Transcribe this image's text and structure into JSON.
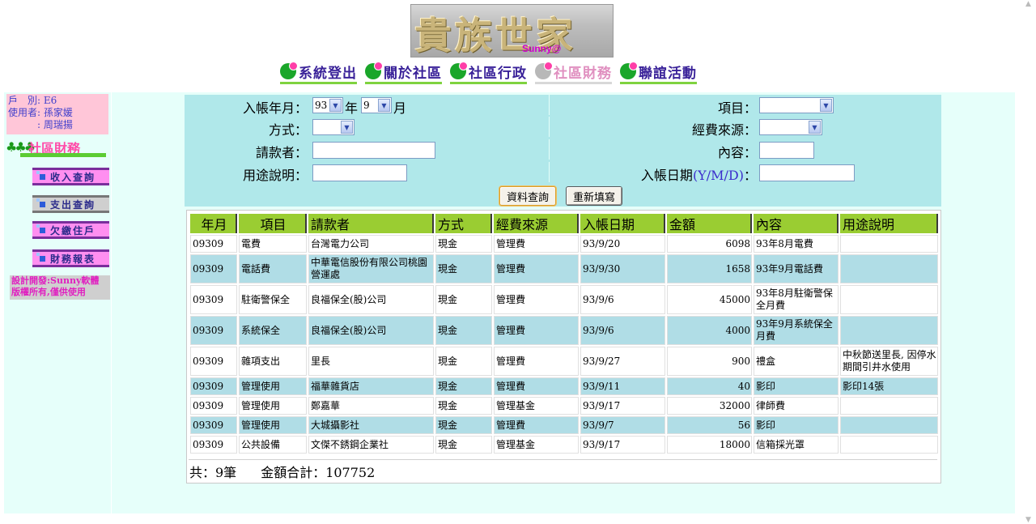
{
  "header": {
    "logo_title": "貴族世家",
    "logo_sub": "Sunny@",
    "nav": [
      "系統登出",
      "關於社區",
      "社區行政",
      "社區財務",
      "聯誼活動"
    ]
  },
  "sidebar": {
    "user_lines": [
      "戶　別: E6",
      "使用者: 孫家媛",
      "　　　: 周瑞揚"
    ],
    "section_title": "社區財務",
    "menu": [
      "收入查詢",
      "支出查詢",
      "欠繳住戶",
      "財務報表"
    ],
    "credit": [
      "設計開發:Sunny軟體",
      "版權所有,僅供使用"
    ]
  },
  "form": {
    "month_label": "入帳年月：",
    "year_value": "93",
    "year_unit": "年",
    "month_value": "9",
    "month_unit": "月",
    "item_label": "項目：",
    "item_value": "",
    "method_label": "方式：",
    "method_value": "",
    "source_label": "經費來源：",
    "source_value": "",
    "requester_label": "請款者：",
    "requester_value": "",
    "content_label": "內容：",
    "content_value": "",
    "purpose_label": "用途說明：",
    "purpose_value": "",
    "date_label": "入帳日期",
    "date_format": "(Y/M/D)",
    "date_colon": "：",
    "date_value": "",
    "query_button": "資料查詢",
    "reset_button": "重新填寫"
  },
  "table": {
    "headers": [
      "年月",
      "項目",
      "請款者",
      "方式",
      "經費來源",
      "入帳日期",
      "金額",
      "內容",
      "用途說明"
    ],
    "rows": [
      [
        "09309",
        "電費",
        "台灣電力公司",
        "現金",
        "管理費",
        "93/9/20",
        "6098",
        "93年8月電費",
        ""
      ],
      [
        "09309",
        "電話費",
        "中華電信股份有限公司桃園營運處",
        "現金",
        "管理費",
        "93/9/30",
        "1658",
        "93年9月電話費",
        ""
      ],
      [
        "09309",
        "駐衛警保全",
        "良福保全(股)公司",
        "現金",
        "管理費",
        "93/9/6",
        "45000",
        "93年8月駐衛警保全月費",
        ""
      ],
      [
        "09309",
        "系統保全",
        "良福保全(股)公司",
        "現金",
        "管理費",
        "93/9/6",
        "4000",
        "93年9月系統保全月費",
        ""
      ],
      [
        "09309",
        "雜項支出",
        "里長",
        "現金",
        "管理費",
        "93/9/27",
        "900",
        "禮盒",
        "中秋節送里長, 因停水期間引井水使用"
      ],
      [
        "09309",
        "管理使用",
        "福華雜貨店",
        "現金",
        "管理費",
        "93/9/11",
        "40",
        "影印",
        "影印14張"
      ],
      [
        "09309",
        "管理使用",
        "鄭嘉華",
        "現金",
        "管理基金",
        "93/9/17",
        "32000",
        "律師費",
        ""
      ],
      [
        "09309",
        "管理使用",
        "大城攝影社",
        "現金",
        "管理費",
        "93/9/7",
        "56",
        "影印",
        ""
      ],
      [
        "09309",
        "公共設備",
        "文傑不銹鋼企業社",
        "現金",
        "管理基金",
        "93/9/17",
        "18000",
        "信箱採光罩",
        ""
      ]
    ],
    "summary_count": "共：9筆",
    "summary_total": "金額合計：107752"
  },
  "colors": {
    "page_bg": "#e6fffa",
    "form_bg": "#b0e8ea",
    "header_green": "#9acd32",
    "row_alt": "#b0dde6",
    "user_box": "#ffc6d8",
    "menu_pink": "#ff8ff0"
  }
}
